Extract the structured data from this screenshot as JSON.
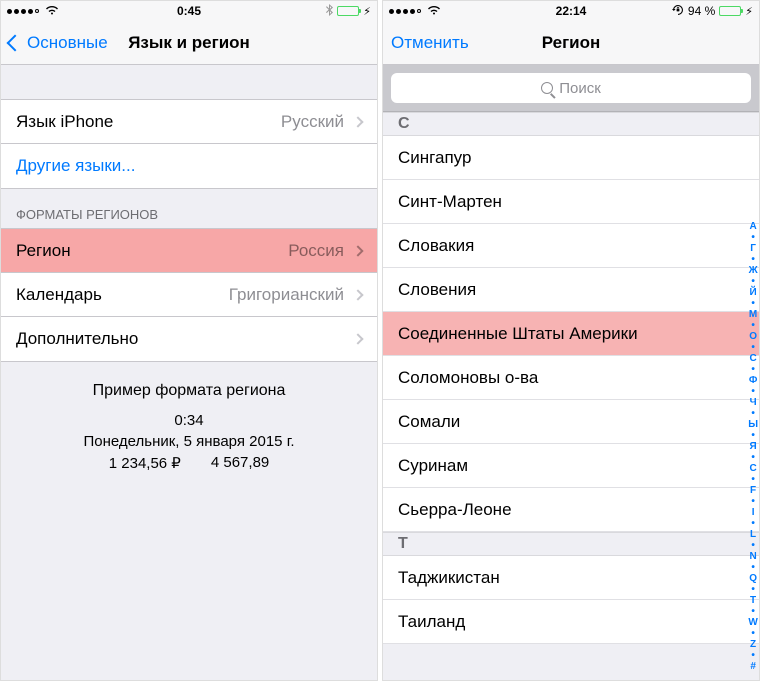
{
  "left": {
    "statusbar": {
      "time": "0:45"
    },
    "nav": {
      "back": "Основные",
      "title": "Язык и регион"
    },
    "rows": {
      "iphone_lang_label": "Язык iPhone",
      "iphone_lang_value": "Русский",
      "other_langs": "Другие языки...",
      "region_label": "Регион",
      "region_value": "Россия",
      "calendar_label": "Календарь",
      "calendar_value": "Григорианский",
      "advanced": "Дополнительно"
    },
    "section_header": "ФОРМАТЫ РЕГИОНОВ",
    "example": {
      "title": "Пример формата региона",
      "time": "0:34",
      "date": "Понедельник, 5 января 2015 г.",
      "num1": "1 234,56 ₽",
      "num2": "4 567,89"
    }
  },
  "right": {
    "statusbar": {
      "time": "22:14",
      "battery_pct": "94 %"
    },
    "nav": {
      "cancel": "Отменить",
      "title": "Регион"
    },
    "search_placeholder": "Поиск",
    "sections": [
      {
        "letter": "С",
        "items": [
          {
            "name": "Сингапур",
            "highlight": false
          },
          {
            "name": "Синт-Мартен",
            "highlight": false
          },
          {
            "name": "Словакия",
            "highlight": false
          },
          {
            "name": "Словения",
            "highlight": false
          },
          {
            "name": "Соединенные Штаты Америки",
            "highlight": true
          },
          {
            "name": "Соломоновы о-ва",
            "highlight": false
          },
          {
            "name": "Сомали",
            "highlight": false
          },
          {
            "name": "Суринам",
            "highlight": false
          },
          {
            "name": "Сьерра-Леоне",
            "highlight": false
          }
        ]
      },
      {
        "letter": "Т",
        "items": [
          {
            "name": "Таджикистан",
            "highlight": false
          },
          {
            "name": "Таиланд",
            "highlight": false
          }
        ]
      }
    ],
    "index_rail": [
      "А",
      "•",
      "Г",
      "•",
      "Ж",
      "•",
      "Й",
      "•",
      "М",
      "•",
      "О",
      "•",
      "С",
      "•",
      "Ф",
      "•",
      "Ч",
      "•",
      "Ы",
      "•",
      "Я",
      "•",
      "C",
      "•",
      "F",
      "•",
      "I",
      "•",
      "L",
      "•",
      "N",
      "•",
      "Q",
      "•",
      "T",
      "•",
      "W",
      "•",
      "Z",
      "•",
      "#"
    ]
  }
}
